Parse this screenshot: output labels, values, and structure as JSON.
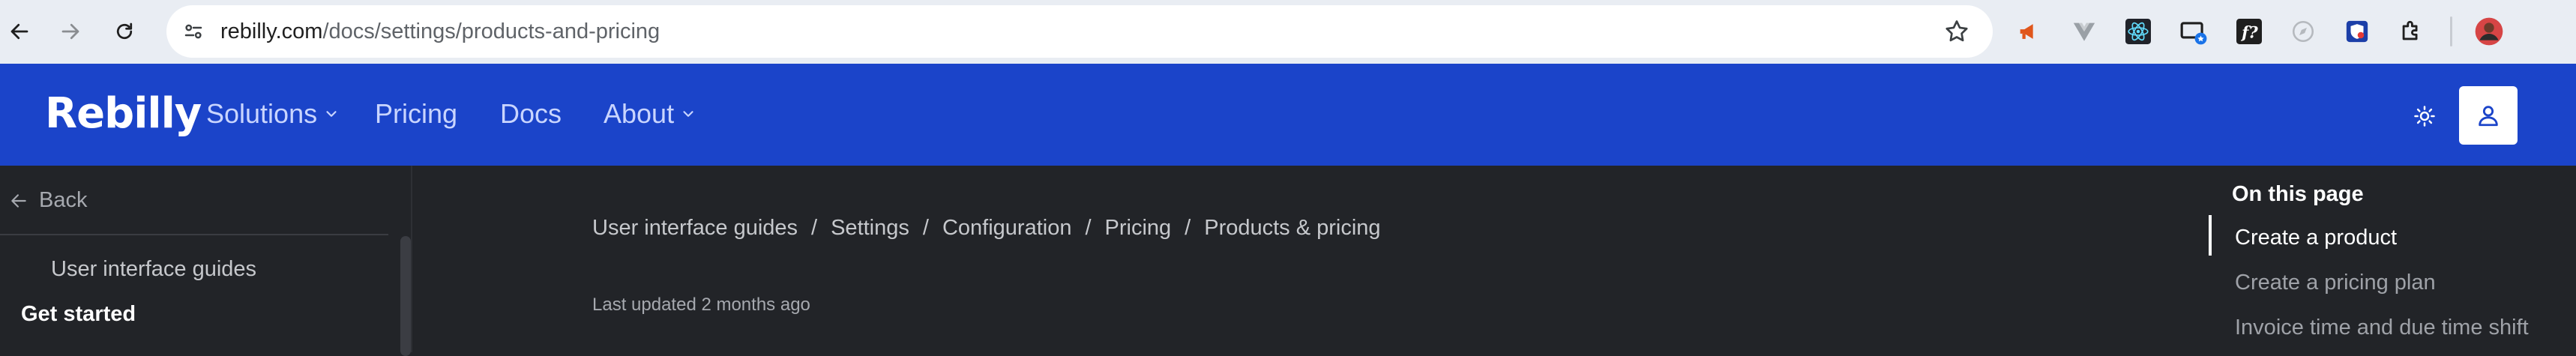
{
  "browser": {
    "url_host": "rebilly.com",
    "url_path": "/docs/settings/products-and-pricing",
    "extensions": [
      "megaphone-icon",
      "vue-icon",
      "react-icon",
      "cast-icon",
      "function-icon",
      "compass-icon",
      "shield-icon",
      "puzzle-icon",
      "avatar"
    ]
  },
  "header": {
    "logo": "Rebilly",
    "nav": [
      {
        "label": "Solutions",
        "has_menu": true
      },
      {
        "label": "Pricing",
        "has_menu": false
      },
      {
        "label": "Docs",
        "has_menu": false
      },
      {
        "label": "About",
        "has_menu": true
      }
    ],
    "brand_color": "#1b44c9"
  },
  "sidebar": {
    "back_label": "Back",
    "items": [
      {
        "label": "User interface guides"
      }
    ],
    "section": "Get started"
  },
  "main": {
    "breadcrumb": [
      "User interface guides",
      "Settings",
      "Configuration",
      "Pricing",
      "Products & pricing"
    ],
    "breadcrumb_separator": "/",
    "last_updated": "Last updated 2 months ago"
  },
  "toc": {
    "title": "On this page",
    "items": [
      {
        "label": "Create a product",
        "active": true
      },
      {
        "label": "Create a pricing plan",
        "active": false
      },
      {
        "label": "Invoice time and due time shift",
        "active": false
      }
    ]
  }
}
